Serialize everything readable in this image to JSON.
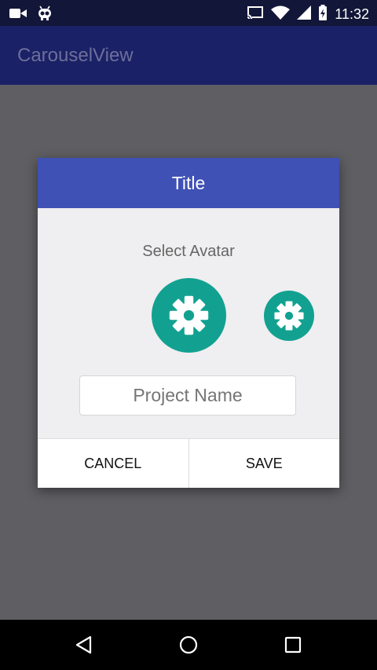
{
  "status_bar": {
    "time": "11:32",
    "left_icons": [
      "video-camera-icon",
      "android-debug-icon"
    ],
    "right_icons": [
      "cast-icon",
      "wifi-icon",
      "cell-signal-icon",
      "battery-icon"
    ]
  },
  "app_bar": {
    "title": "CarouselView"
  },
  "dialog": {
    "title": "Title",
    "subtitle": "Select Avatar",
    "avatars": [
      "gear-icon",
      "gear-icon"
    ],
    "project_name": {
      "placeholder": "Project Name",
      "value": ""
    },
    "cancel_label": "CANCEL",
    "save_label": "SAVE"
  },
  "nav_bar": {
    "icons": [
      "back-icon",
      "home-icon",
      "recents-icon"
    ]
  },
  "colors": {
    "status_bar": "#121638",
    "app_bar": "#1b2166",
    "dialog_header": "#3f51b5",
    "avatar": "#12a191",
    "scrim": "#5f5f63"
  }
}
